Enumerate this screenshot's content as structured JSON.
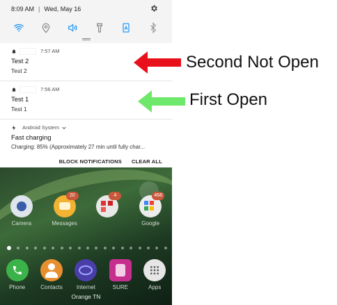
{
  "status_bar": {
    "time": "8:09 AM",
    "separator": "|",
    "date": "Wed, May 16"
  },
  "quick_settings": [
    "wifi-icon",
    "location-icon",
    "sound-icon",
    "flashlight-icon",
    "auto-rotate-icon",
    "bluetooth-icon"
  ],
  "notifications": [
    {
      "time": "7:57 AM",
      "title": "Test 2",
      "text": "Test 2"
    },
    {
      "time": "7:56 AM",
      "title": "Test 1",
      "text": "Test 1"
    },
    {
      "app": "Android System",
      "title": "Fast charging",
      "text": "Charging: 85% (Approximately 27 min until fully char..."
    }
  ],
  "actions": {
    "block": "BLOCK NOTIFICATIONS",
    "clear": "CLEAR ALL"
  },
  "home_apps_row1": [
    {
      "label": "Camera",
      "badge": ""
    },
    {
      "label": "Messages",
      "badge": "20"
    },
    {
      "label": "",
      "badge": "4"
    },
    {
      "label": "Google",
      "badge": "468"
    }
  ],
  "home_apps_row2": [
    {
      "label": "Phone"
    },
    {
      "label": "Contacts"
    },
    {
      "label": "Internet"
    },
    {
      "label": "SURE"
    },
    {
      "label": "Apps"
    }
  ],
  "carrier": "Orange TN",
  "annotations": {
    "second": "Second Not Open",
    "first": "First Open"
  },
  "colors": {
    "accent_blue": "#2196f3",
    "arrow_red": "#e8101a",
    "arrow_green": "#6ee86a"
  }
}
